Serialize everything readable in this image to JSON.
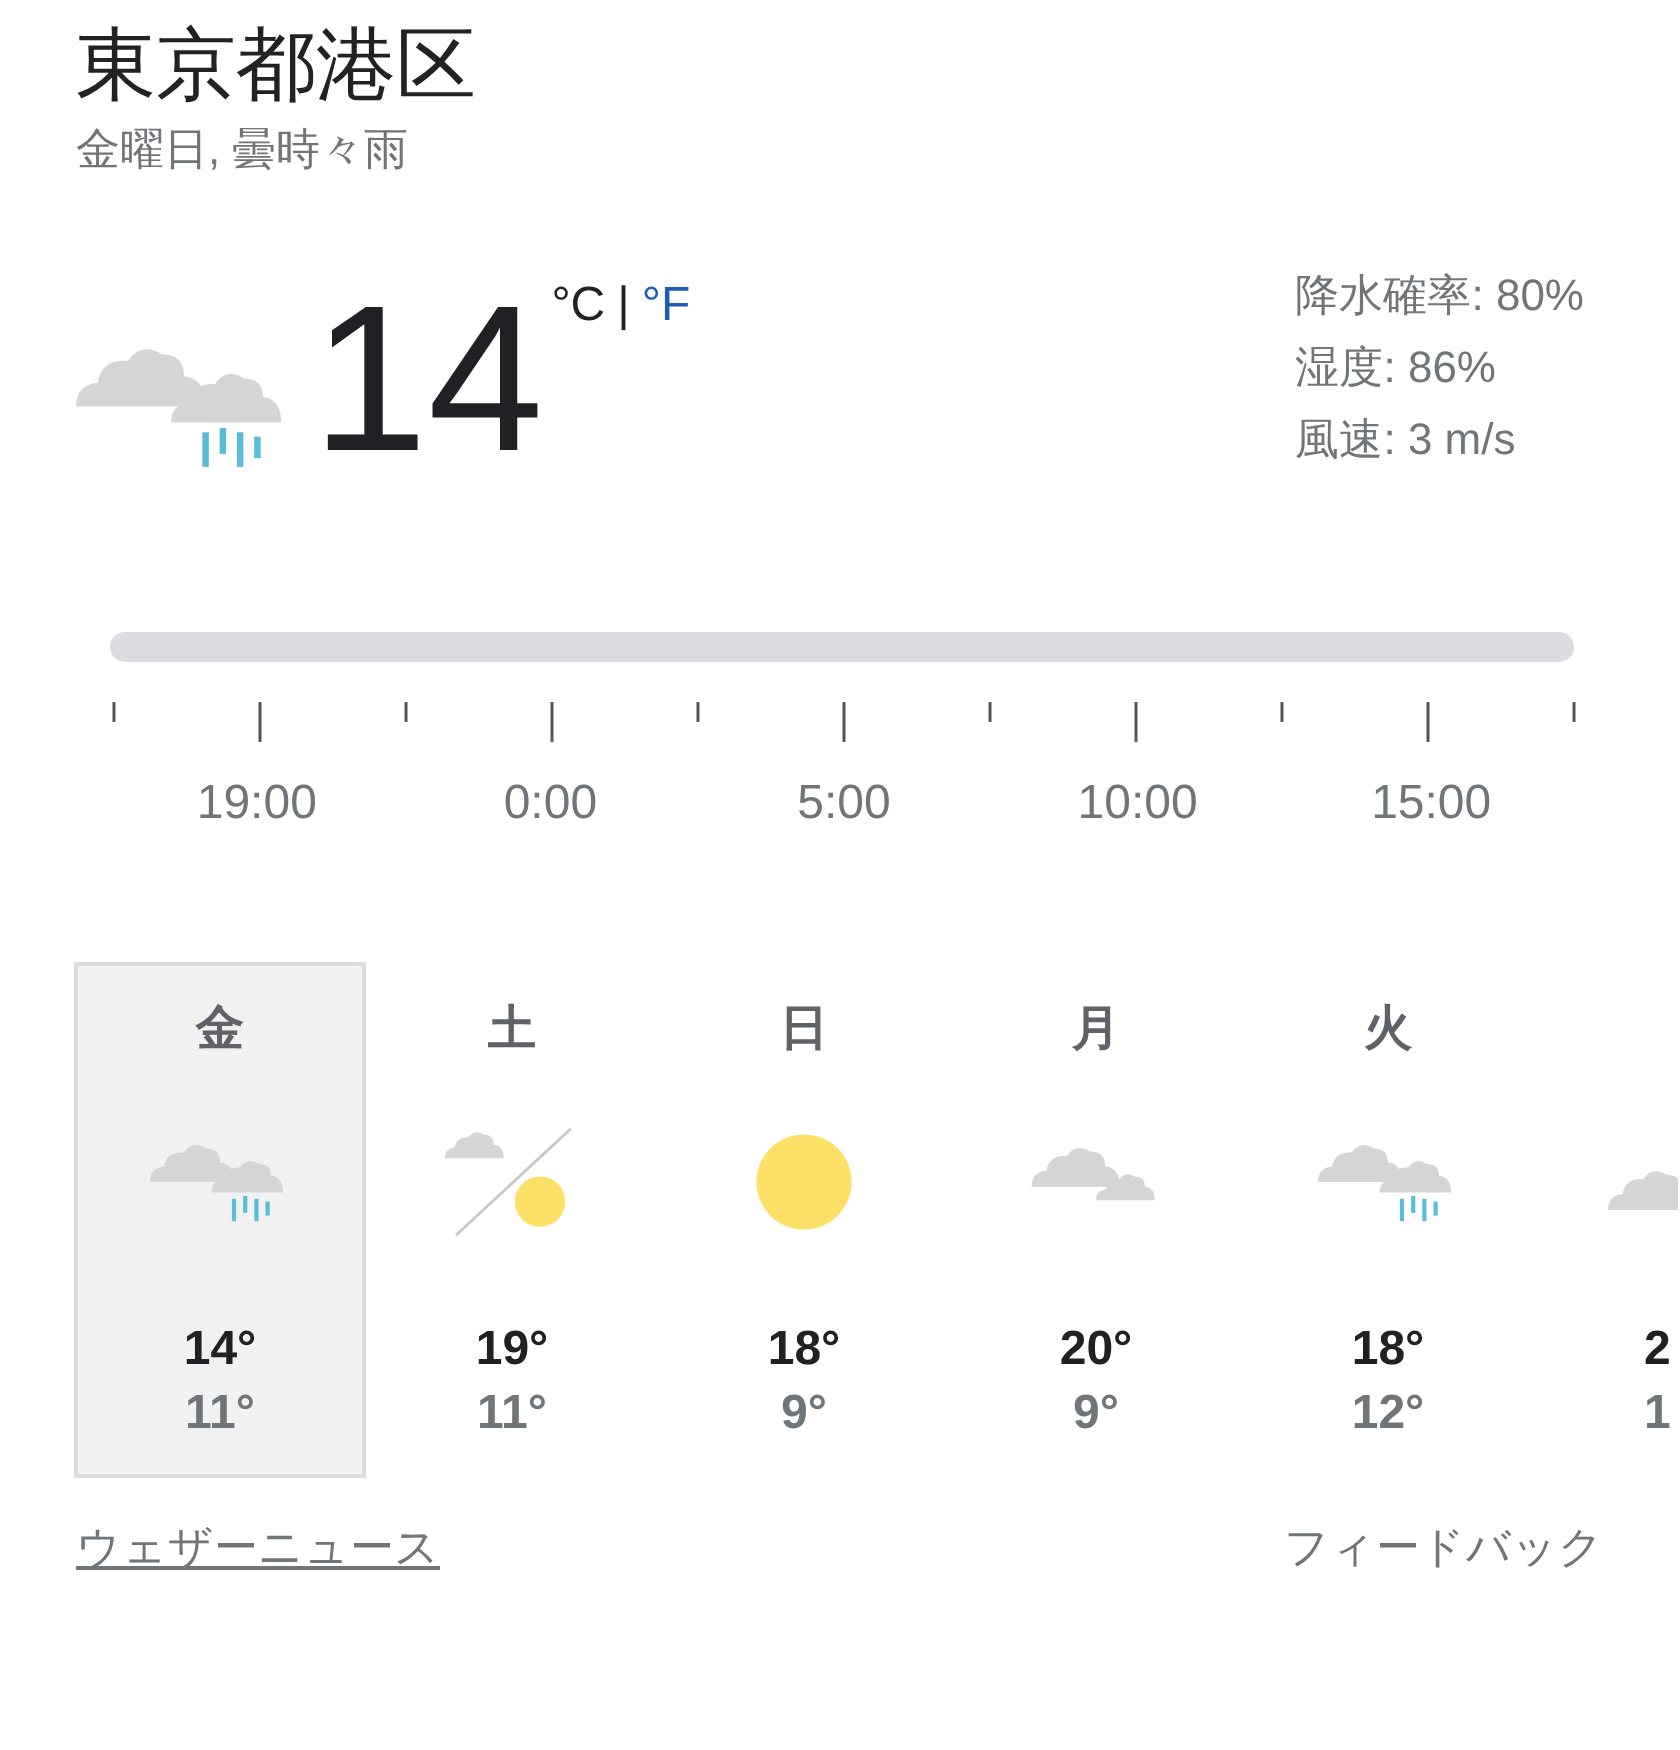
{
  "location": "東京都港区",
  "subtitle": "金曜日, 曇時々雨",
  "current": {
    "kind": "rain",
    "temperature": "14",
    "unit_c": "°C",
    "separator": "|",
    "unit_f": "°F",
    "details": [
      "降水確率: 80%",
      "湿度: 86%",
      "風速: 3 m/s"
    ]
  },
  "timeline": {
    "labels": [
      "19:00",
      "0:00",
      "5:00",
      "10:00",
      "15:00"
    ]
  },
  "days": [
    {
      "day": "金",
      "kind": "rain",
      "high": "14°",
      "low": "11°",
      "selected": true
    },
    {
      "day": "土",
      "kind": "partly",
      "high": "19°",
      "low": "11°",
      "selected": false
    },
    {
      "day": "日",
      "kind": "sun",
      "high": "18°",
      "low": "9°",
      "selected": false
    },
    {
      "day": "月",
      "kind": "cloudy",
      "high": "20°",
      "low": "9°",
      "selected": false
    },
    {
      "day": "火",
      "kind": "rain",
      "high": "18°",
      "low": "12°",
      "selected": false
    },
    {
      "kind": "cloudy",
      "high": "2",
      "low": "1",
      "selected": false
    }
  ],
  "footer": {
    "news_link": "ウェザーニュース",
    "feedback_link": "フィードバック"
  }
}
